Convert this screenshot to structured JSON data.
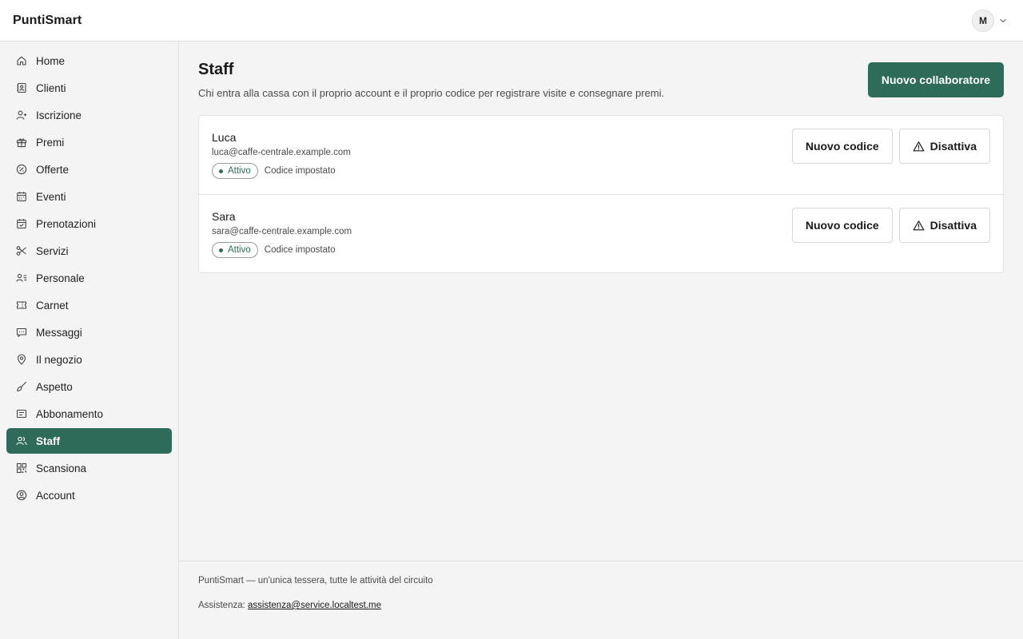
{
  "header": {
    "brand": "PuntiSmart",
    "user_initial": "M"
  },
  "sidebar": {
    "items": [
      {
        "label": "Home",
        "icon": "home-icon"
      },
      {
        "label": "Clienti",
        "icon": "contacts-icon"
      },
      {
        "label": "Iscrizione",
        "icon": "user-plus-icon"
      },
      {
        "label": "Premi",
        "icon": "gift-icon"
      },
      {
        "label": "Offerte",
        "icon": "badge-percent-icon"
      },
      {
        "label": "Eventi",
        "icon": "calendar-icon"
      },
      {
        "label": "Prenotazioni",
        "icon": "calendar-check-icon"
      },
      {
        "label": "Servizi",
        "icon": "scissors-icon"
      },
      {
        "label": "Personale",
        "icon": "user-list-icon"
      },
      {
        "label": "Carnet",
        "icon": "ticket-icon"
      },
      {
        "label": "Messaggi",
        "icon": "message-icon"
      },
      {
        "label": "Il negozio",
        "icon": "map-pin-icon"
      },
      {
        "label": "Aspetto",
        "icon": "paintbrush-icon"
      },
      {
        "label": "Abbonamento",
        "icon": "receipt-icon"
      },
      {
        "label": "Staff",
        "icon": "users-icon",
        "active": true
      },
      {
        "label": "Scansiona",
        "icon": "qr-scan-icon"
      },
      {
        "label": "Account",
        "icon": "user-circle-icon"
      }
    ]
  },
  "page": {
    "title": "Staff",
    "subtitle": "Chi entra alla cassa con il proprio account e il proprio codice per registrare visite e consegnare premi.",
    "new_button": "Nuovo collaboratore"
  },
  "staff": [
    {
      "name": "Luca",
      "email": "luca@caffe-centrale.example.com",
      "status": "Attivo",
      "code_status": "Codice impostato",
      "new_code_label": "Nuovo codice",
      "deactivate_label": "Disattiva"
    },
    {
      "name": "Sara",
      "email": "sara@caffe-centrale.example.com",
      "status": "Attivo",
      "code_status": "Codice impostato",
      "new_code_label": "Nuovo codice",
      "deactivate_label": "Disattiva"
    }
  ],
  "footer": {
    "tagline": "PuntiSmart — un'unica tessera, tutte le attività del circuito",
    "support_label": "Assistenza:",
    "support_email": "assistenza@service.localtest.me"
  },
  "colors": {
    "accent": "#2e6b5b",
    "background": "#f4f4f4",
    "surface": "#ffffff",
    "border": "#e2e2e2"
  }
}
